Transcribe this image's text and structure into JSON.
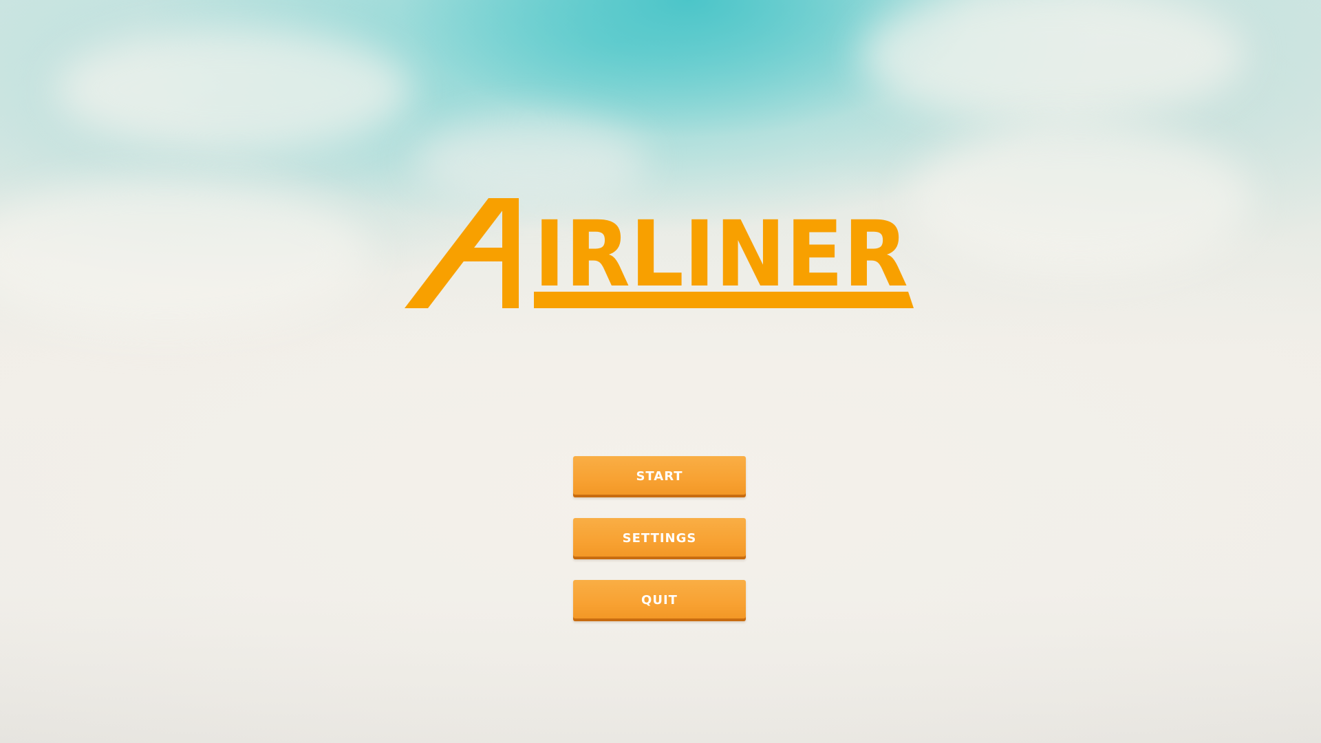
{
  "game": {
    "title": "AIRLINER",
    "brand_color": "#f8a000"
  },
  "main_menu": {
    "buttons": [
      {
        "label": "START"
      },
      {
        "label": "SETTINGS"
      },
      {
        "label": "QUIT"
      }
    ],
    "button_color": "#f8a233",
    "button_text_color": "#ffffff"
  },
  "background": {
    "description_colors": {
      "sky": "#5cc8c8",
      "cloud": "#f1eee8"
    }
  }
}
